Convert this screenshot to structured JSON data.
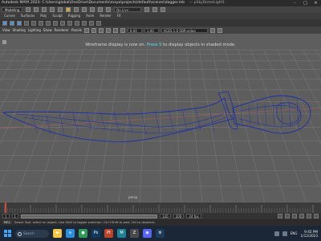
{
  "window": {
    "title": "Autodesk MAYA 2023: C:\\Users\\global\\OneDrive\\Documents\\maya\\projects\\default\\scenes\\dagger.mb",
    "subtitle": "— pSkyDomeLight1",
    "controls": [
      "–",
      "□",
      "✕"
    ]
  },
  "menubar": {
    "mode_dropdown": "Modeling",
    "live_field": "No Live Surface"
  },
  "toolbar": {
    "tabs": [
      "Curves",
      "Surfaces",
      "Poly",
      "Sculpt",
      "Rigging",
      "Anim",
      "Render",
      "FX"
    ]
  },
  "panel_menu": {
    "items": [
      "View",
      "Shading",
      "Lighting",
      "Show",
      "Renderer",
      "Panels"
    ],
    "field_a": "0.00",
    "field_b": "1.00",
    "field_c": "ACES 1.0 SDR-video (sRGB)"
  },
  "viewport": {
    "hud_message_before": "Wireframe display is now on.",
    "hud_key": "Press 5",
    "hud_message_after": "to display objects in shaded mode.",
    "camera_label": "persp",
    "colors": {
      "background": "#5e5e5e",
      "grid": "#7a7a7a",
      "wire": "#1c2fa8",
      "axis": "#a06060"
    }
  },
  "timeline": {
    "start": "1",
    "end": "120",
    "range_start": "1",
    "range_end": "120",
    "anim_end": "200",
    "current": "1",
    "fps": "24 fps"
  },
  "command_line": {
    "lang": "MEL",
    "help": "Select Tool: select an object. Use Shift to toggle selection. Ctrl+Shift to add, Ctrl to deselect."
  },
  "taskbar": {
    "search_placeholder": "Search",
    "apps": [
      {
        "icon": "file-explorer-icon",
        "glyph": "▬",
        "color": "#f4c443"
      },
      {
        "icon": "edge-icon",
        "glyph": "e",
        "color": "#2a8fd8"
      },
      {
        "icon": "chrome-icon",
        "glyph": "●",
        "color": "#2f9b57"
      },
      {
        "icon": "photoshop-icon",
        "glyph": "Ps",
        "color": "#0f3a5e"
      },
      {
        "icon": "substance-icon",
        "glyph": "Pt",
        "color": "#b8442a"
      },
      {
        "icon": "maya-icon",
        "glyph": "M",
        "color": "#1f7f93"
      },
      {
        "icon": "zbrush-icon",
        "glyph": "Z",
        "color": "#4a4a4a"
      },
      {
        "icon": "discord-icon",
        "glyph": "◉",
        "color": "#5865f2"
      },
      {
        "icon": "steam-icon",
        "glyph": "⚙",
        "color": "#1d3b5a"
      }
    ],
    "tray_lang": "ENG",
    "time": "9:45 PM",
    "date": "1/12/2023"
  }
}
